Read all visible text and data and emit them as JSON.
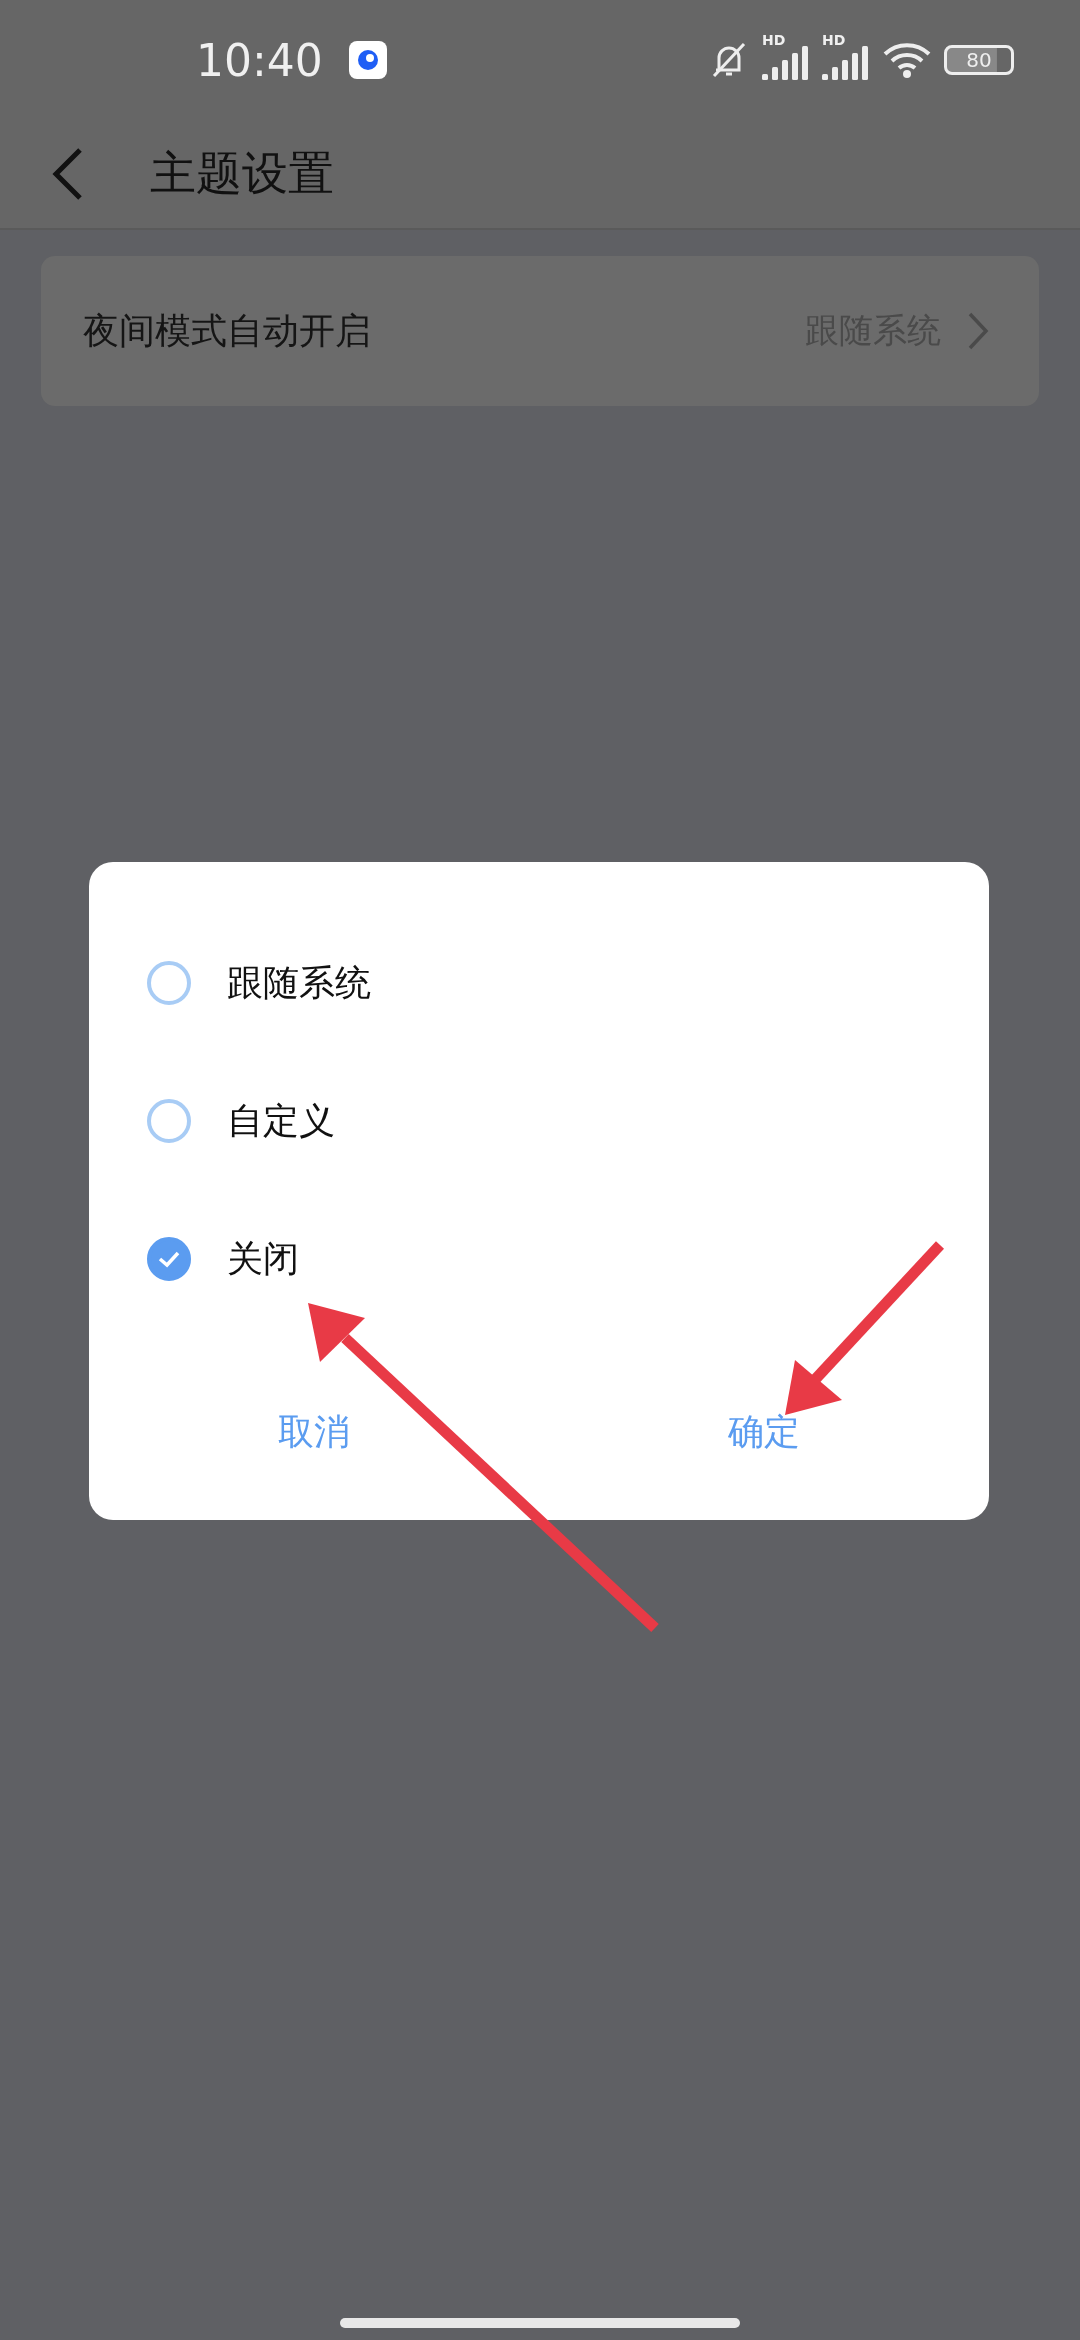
{
  "status_bar": {
    "time": "10:40",
    "signals": [
      {
        "label": "HD"
      },
      {
        "label": "HD"
      }
    ],
    "battery": "80"
  },
  "header": {
    "title": "主题设置"
  },
  "settings": [
    {
      "label": "夜间模式自动开启",
      "value": "跟随系统"
    }
  ],
  "dialog": {
    "options": [
      {
        "label": "跟随系统",
        "selected": false
      },
      {
        "label": "自定义",
        "selected": false
      },
      {
        "label": "关闭",
        "selected": true
      }
    ],
    "buttons": [
      "取消",
      "确定"
    ]
  }
}
